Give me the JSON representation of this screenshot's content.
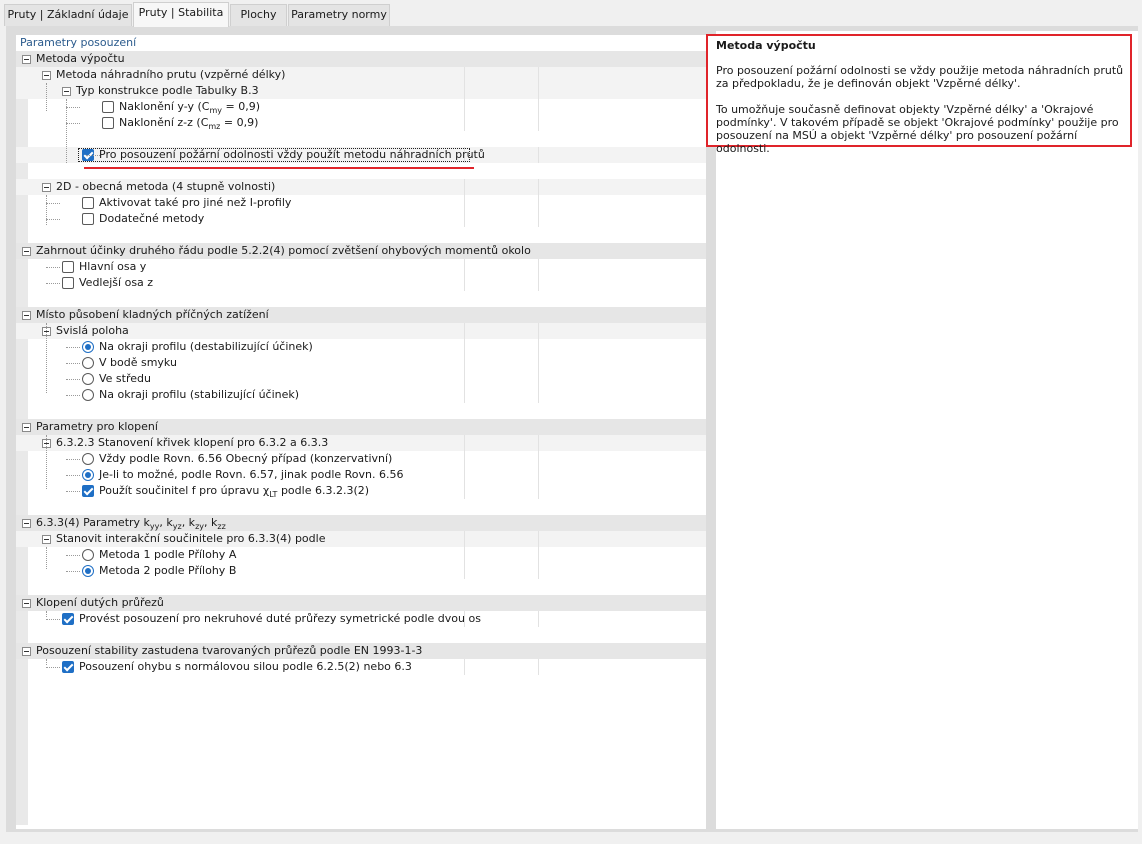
{
  "tabs": [
    {
      "label": "Pruty | Základní údaje",
      "active": false
    },
    {
      "label": "Pruty | Stabilita",
      "active": true
    },
    {
      "label": "Plochy",
      "active": false
    },
    {
      "label": "Parametry normy",
      "active": false
    }
  ],
  "left_pane": {
    "title": "Parametry posouzení"
  },
  "tree": {
    "g1": {
      "label": "Metoda výpočtu"
    },
    "g1_s1": {
      "label": "Metoda náhradního prutu (vzpěrné délky)"
    },
    "g1_s1_s1": {
      "label": "Typ konstrukce podle Tabulky B.3"
    },
    "g1_opt1": {
      "label_pre": "Naklonění y-y (C",
      "label_sub": "my",
      "label_post": " = 0,9)",
      "checked": false
    },
    "g1_opt2": {
      "label_pre": "Naklonění z-z (C",
      "label_sub": "mz",
      "label_post": " = 0,9)",
      "checked": false
    },
    "g1_fire": {
      "label": "Pro posouzení požární odolnosti vždy použít metodu náhradních prutů",
      "checked": true
    },
    "g1_s2": {
      "label": "2D - obecná metoda (4 stupně volnosti)"
    },
    "g1_s2_o1": {
      "label": "Aktivovat také pro jiné než I-profily",
      "checked": false
    },
    "g1_s2_o2": {
      "label": "Dodatečné metody",
      "checked": false
    },
    "g2": {
      "label": "Zahrnout účinky druhého řádu podle 5.2.2(4) pomocí zvětšení ohybových momentů okolo"
    },
    "g2_o1": {
      "label": "Hlavní osa y",
      "checked": false
    },
    "g2_o2": {
      "label": "Vedlejší osa z",
      "checked": false
    },
    "g3": {
      "label": "Místo působení kladných příčných zatížení"
    },
    "g3_s1": {
      "label": "Svislá poloha"
    },
    "g3_r1": {
      "label": "Na okraji profilu (destabilizující účinek)",
      "checked": true
    },
    "g3_r2": {
      "label": "V bodě smyku",
      "checked": false
    },
    "g3_r3": {
      "label": "Ve středu",
      "checked": false
    },
    "g3_r4": {
      "label": "Na okraji profilu (stabilizující účinek)",
      "checked": false
    },
    "g4": {
      "label": "Parametry pro klopení"
    },
    "g4_s1": {
      "label": "6.3.2.3 Stanovení křivek klopení pro 6.3.2 a 6.3.3"
    },
    "g4_r1": {
      "label": "Vždy podle Rovn. 6.56 Obecný případ (konzervativní)",
      "checked": false
    },
    "g4_r2": {
      "label": "Je-li to možné, podle Rovn. 6.57, jinak podle Rovn. 6.56",
      "checked": true
    },
    "g4_c1": {
      "label_pre": "Použít součinitel f pro úpravu χ",
      "label_sub": "LT",
      "label_post": " podle 6.3.2.3(2)",
      "checked": true
    },
    "g5": {
      "label_pre": "6.3.3(4) Parametry k",
      "s1": "yy",
      "m1": ", k",
      "s2": "yz",
      "m2": ", k",
      "s3": "zy",
      "m3": ", k",
      "s4": "zz"
    },
    "g5_s1": {
      "label": "Stanovit interakční součinitele pro 6.3.3(4) podle"
    },
    "g5_r1": {
      "label": "Metoda 1 podle Přílohy A",
      "checked": false
    },
    "g5_r2": {
      "label": "Metoda 2 podle Přílohy B",
      "checked": true
    },
    "g6": {
      "label": "Klopení dutých průřezů"
    },
    "g6_c1": {
      "label": "Provést posouzení pro nekruhové duté průřezy symetrické podle dvou os",
      "checked": true
    },
    "g7": {
      "label": "Posouzení stability zastudena tvarovaných průřezů podle EN 1993-1-3"
    },
    "g7_c1": {
      "label": "Posouzení ohybu s normálovou silou podle 6.2.5(2) nebo 6.3",
      "checked": true
    }
  },
  "info": {
    "title": "Metoda výpočtu",
    "p1": "Pro posouzení požární odolnosti se vždy použije metoda náhradních prutů za předpokladu, že je definován objekt 'Vzpěrné délky'.",
    "p2": "To umožňuje současně definovat objekty 'Vzpěrné délky' a 'Okrajové podmínky'. V takovém případě se objekt 'Okrajové podmínky' použije pro posouzení na MSÚ a objekt 'Vzpěrné délky' pro posouzení požární odolnosti.",
    "highlight_color": "#e0242a",
    "accent_color": "#1f6fc5"
  }
}
